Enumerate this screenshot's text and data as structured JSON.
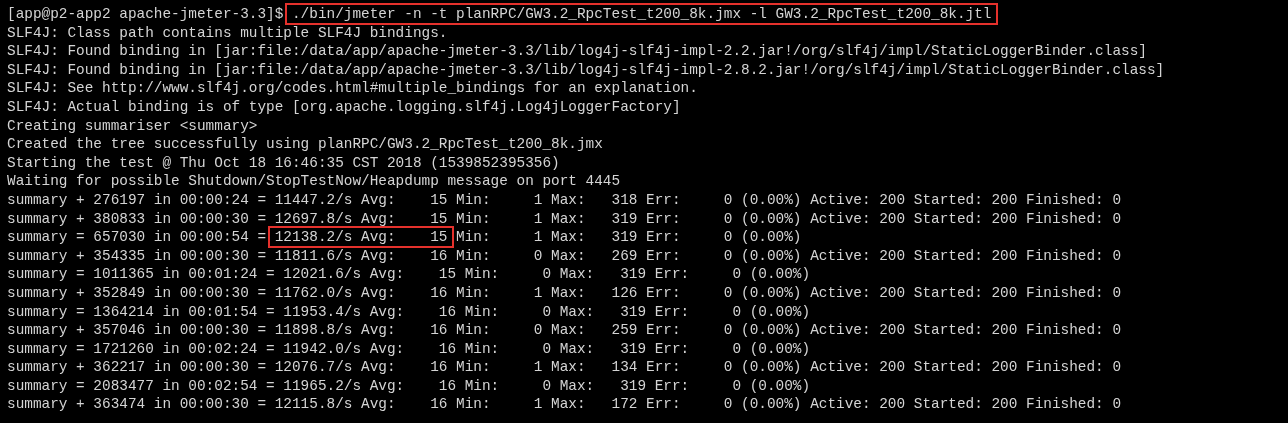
{
  "terminal": {
    "lines": [
      {
        "segments": [
          {
            "text": "[app@p2-app2 apache-jmeter-3.3]$ ",
            "boxed": false
          },
          {
            "text": "./bin/jmeter -n -t planRPC/GW3.2_RpcTest_t200_8k.jmx -l GW3.2_RpcTest_t200_8k.jtl",
            "boxed": true
          }
        ]
      },
      {
        "segments": [
          {
            "text": "SLF4J: Class path contains multiple SLF4J bindings.",
            "boxed": false
          }
        ]
      },
      {
        "segments": [
          {
            "text": "SLF4J: Found binding in [jar:file:/data/app/apache-jmeter-3.3/lib/log4j-slf4j-impl-2.2.jar!/org/slf4j/impl/StaticLoggerBinder.class]",
            "boxed": false
          }
        ]
      },
      {
        "segments": [
          {
            "text": "SLF4J: Found binding in [jar:file:/data/app/apache-jmeter-3.3/lib/log4j-slf4j-impl-2.8.2.jar!/org/slf4j/impl/StaticLoggerBinder.class]",
            "boxed": false
          }
        ]
      },
      {
        "segments": [
          {
            "text": "SLF4J: See http://www.slf4j.org/codes.html#multiple_bindings for an explanation.",
            "boxed": false
          }
        ]
      },
      {
        "segments": [
          {
            "text": "SLF4J: Actual binding is of type [org.apache.logging.slf4j.Log4jLoggerFactory]",
            "boxed": false
          }
        ]
      },
      {
        "segments": [
          {
            "text": "Creating summariser <summary>",
            "boxed": false
          }
        ]
      },
      {
        "segments": [
          {
            "text": "Created the tree successfully using planRPC/GW3.2_RpcTest_t200_8k.jmx",
            "boxed": false
          }
        ]
      },
      {
        "segments": [
          {
            "text": "Starting the test @ Thu Oct 18 16:46:35 CST 2018 (1539852395356)",
            "boxed": false
          }
        ]
      },
      {
        "segments": [
          {
            "text": "Waiting for possible Shutdown/StopTestNow/Heapdump message on port 4445",
            "boxed": false
          }
        ]
      },
      {
        "segments": [
          {
            "text": "summary + 276197 in 00:00:24 = 11447.2/s Avg:    15 Min:     1 Max:   318 Err:     0 (0.00%) Active: 200 Started: 200 Finished: 0",
            "boxed": false
          }
        ]
      },
      {
        "segments": [
          {
            "text": "summary + 380833 in 00:00:30 = 12697.8/s Avg:    15 Min:     1 Max:   319 Err:     0 (0.00%) Active: 200 Started: 200 Finished: 0",
            "boxed": false
          }
        ]
      },
      {
        "segments": [
          {
            "text": "summary = 657030 in 00:00:54 = ",
            "boxed": false
          },
          {
            "text": "12138.2/s Avg:    15",
            "boxed": true
          },
          {
            "text": " Min:     1 Max:   319 Err:     0 (0.00%)",
            "boxed": false
          }
        ]
      },
      {
        "segments": [
          {
            "text": "summary + 354335 in 00:00:30 = 11811.6/s Avg:    16 Min:     0 Max:   269 Err:     0 (0.00%) Active: 200 Started: 200 Finished: 0",
            "boxed": false
          }
        ]
      },
      {
        "segments": [
          {
            "text": "summary = 1011365 in 00:01:24 = 12021.6/s Avg:    15 Min:     0 Max:   319 Err:     0 (0.00%)",
            "boxed": false
          }
        ]
      },
      {
        "segments": [
          {
            "text": "summary + 352849 in 00:00:30 = 11762.0/s Avg:    16 Min:     1 Max:   126 Err:     0 (0.00%) Active: 200 Started: 200 Finished: 0",
            "boxed": false
          }
        ]
      },
      {
        "segments": [
          {
            "text": "summary = 1364214 in 00:01:54 = 11953.4/s Avg:    16 Min:     0 Max:   319 Err:     0 (0.00%)",
            "boxed": false
          }
        ]
      },
      {
        "segments": [
          {
            "text": "summary + 357046 in 00:00:30 = 11898.8/s Avg:    16 Min:     0 Max:   259 Err:     0 (0.00%) Active: 200 Started: 200 Finished: 0",
            "boxed": false
          }
        ]
      },
      {
        "segments": [
          {
            "text": "summary = 1721260 in 00:02:24 = 11942.0/s Avg:    16 Min:     0 Max:   319 Err:     0 (0.00%)",
            "boxed": false
          }
        ]
      },
      {
        "segments": [
          {
            "text": "summary + 362217 in 00:00:30 = 12076.7/s Avg:    16 Min:     1 Max:   134 Err:     0 (0.00%) Active: 200 Started: 200 Finished: 0",
            "boxed": false
          }
        ]
      },
      {
        "segments": [
          {
            "text": "summary = 2083477 in 00:02:54 = 11965.2/s Avg:    16 Min:     0 Max:   319 Err:     0 (0.00%)",
            "boxed": false
          }
        ]
      },
      {
        "segments": [
          {
            "text": "summary + 363474 in 00:00:30 = 12115.8/s Avg:    16 Min:     1 Max:   172 Err:     0 (0.00%) Active: 200 Started: 200 Finished: 0",
            "boxed": false
          }
        ]
      }
    ]
  }
}
